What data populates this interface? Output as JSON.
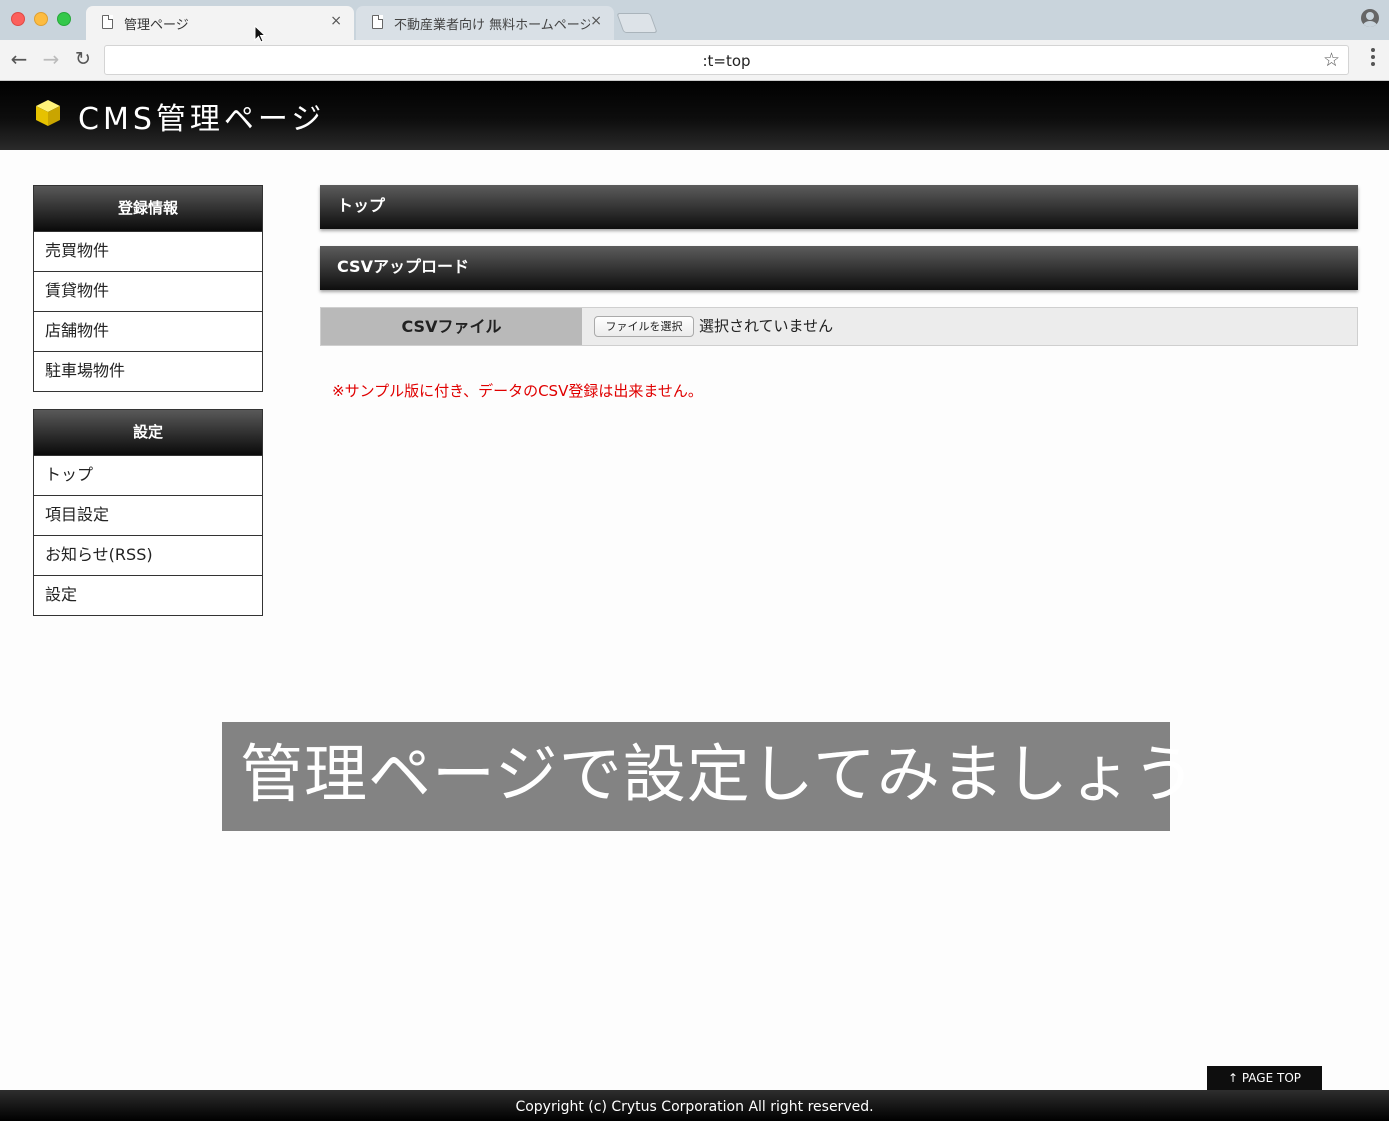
{
  "browser": {
    "tabs": [
      {
        "title": "管理ページ",
        "close": "×"
      },
      {
        "title": "不動産業者向け 無料ホームページ",
        "close": "×"
      }
    ],
    "url": ":t=top"
  },
  "header": {
    "title": "CMS管理ページ",
    "logo_color": "#f2d100"
  },
  "sidebar": {
    "sections": [
      {
        "heading": "登録情報",
        "items": [
          "売買物件",
          "賃貸物件",
          "店舗物件",
          "駐車場物件"
        ]
      },
      {
        "heading": "設定",
        "items": [
          "トップ",
          "項目設定",
          "お知らせ(RSS)",
          "設定"
        ]
      }
    ]
  },
  "main": {
    "top_heading": "トップ",
    "upload_heading": "CSVアップロード",
    "csv_label": "CSVファイル",
    "file_button": "ファイルを選択",
    "file_status": "選択されていません",
    "notice": "※サンプル版に付き、データのCSV登録は出来ません。",
    "notice_color": "#e00000"
  },
  "overlay": {
    "caption": "管理ページで設定してみましょう"
  },
  "footer": {
    "page_top": "↑ PAGE TOP",
    "copyright": "Copyright (c) Crytus Corporation All right reserved."
  }
}
